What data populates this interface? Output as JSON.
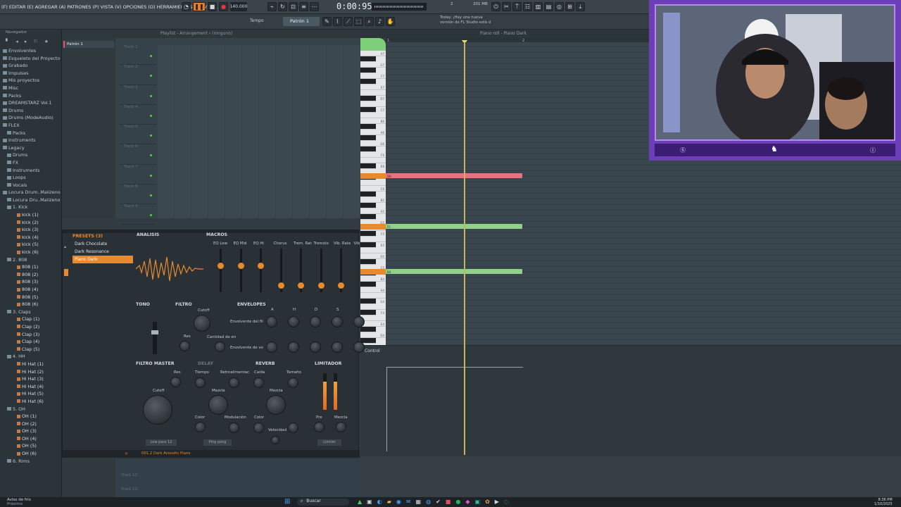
{
  "menu": {
    "items": [
      "(F) EDITAR (E) AGREGAR (A) PATRONES (P) VISTA (V) OPCIONES (O) HERRAMIENTAS (T) AYUDA"
    ]
  },
  "transport": {
    "tempo": "140.000",
    "time": "0:00:95",
    "pattern": "Patrón 1",
    "tempo_label": "Tempo",
    "hint_line1": "Today: ¡Hay una nueva",
    "hint_line2": "versión de FL Studio está d",
    "cpu": "2",
    "mem": "201 MB"
  },
  "browser": {
    "title": "Navegador",
    "items": [
      {
        "label": "Envolventes",
        "level": 1
      },
      {
        "label": "Esqueleto del Proyecto",
        "level": 1
      },
      {
        "label": "Grabado",
        "level": 1
      },
      {
        "label": "Impulses",
        "level": 1
      },
      {
        "label": "Mis proyectos",
        "level": 1
      },
      {
        "label": "Misc",
        "level": 1
      },
      {
        "label": "Packs",
        "level": 0
      },
      {
        "label": "DREAMSTARZ Vol.1",
        "level": 1
      },
      {
        "label": "Drums",
        "level": 1
      },
      {
        "label": "Drums (ModeAudio)",
        "level": 1
      },
      {
        "label": "FLEX",
        "level": 1
      },
      {
        "label": "Packs",
        "level": 2
      },
      {
        "label": "Instruments",
        "level": 1
      },
      {
        "label": "Legacy",
        "level": 1
      },
      {
        "label": "Drums",
        "level": 2
      },
      {
        "label": "FX",
        "level": 2
      },
      {
        "label": "Instruments",
        "level": 2
      },
      {
        "label": "Loops",
        "level": 2
      },
      {
        "label": "Vocals",
        "level": 2
      },
      {
        "label": "Locura Drum..Maiizeno",
        "level": 1
      },
      {
        "label": "Locura Dru..Maiizeno",
        "level": 2
      },
      {
        "label": "1. Kick",
        "level": 2
      },
      {
        "label": "kick (1)",
        "level": 3
      },
      {
        "label": "kick (2)",
        "level": 3
      },
      {
        "label": "kick (3)",
        "level": 3
      },
      {
        "label": "kick (4)",
        "level": 3
      },
      {
        "label": "kick (5)",
        "level": 3
      },
      {
        "label": "kick (6)",
        "level": 3
      },
      {
        "label": "2. 808",
        "level": 2
      },
      {
        "label": "808 (1)",
        "level": 3
      },
      {
        "label": "808 (2)",
        "level": 3
      },
      {
        "label": "808 (3)",
        "level": 3
      },
      {
        "label": "808 (4)",
        "level": 3
      },
      {
        "label": "808 (5)",
        "level": 3
      },
      {
        "label": "808 (6)",
        "level": 3
      },
      {
        "label": "3. Claps",
        "level": 2
      },
      {
        "label": "Clap (1)",
        "level": 3
      },
      {
        "label": "Clap (2)",
        "level": 3
      },
      {
        "label": "Clap (3)",
        "level": 3
      },
      {
        "label": "Clap (4)",
        "level": 3
      },
      {
        "label": "Clap (5)",
        "level": 3
      },
      {
        "label": "4. HH",
        "level": 2
      },
      {
        "label": "Hi Hat (1)",
        "level": 3
      },
      {
        "label": "Hi Hat (2)",
        "level": 3
      },
      {
        "label": "Hi Hat (3)",
        "level": 3
      },
      {
        "label": "Hi Hat (4)",
        "level": 3
      },
      {
        "label": "Hi Hat (5)",
        "level": 3
      },
      {
        "label": "Hi Hat (6)",
        "level": 3
      },
      {
        "label": "5. OH",
        "level": 2
      },
      {
        "label": "OH (1)",
        "level": 3
      },
      {
        "label": "OH (2)",
        "level": 3
      },
      {
        "label": "OH (3)",
        "level": 3
      },
      {
        "label": "OH (4)",
        "level": 3
      },
      {
        "label": "OH (5)",
        "level": 3
      },
      {
        "label": "OH (6)",
        "level": 3
      },
      {
        "label": "6. Rims",
        "level": 2
      }
    ]
  },
  "playlist": {
    "title": "Playlist - Arrangement › (ninguno)",
    "pattern_item": "Patrón 1",
    "tracks": [
      "Track 1",
      "Track 2",
      "Track 3",
      "Track 4",
      "Track 5",
      "Track 6",
      "Track 7",
      "Track 8",
      "Track 9"
    ],
    "bottom_tracks": [
      "Track 12",
      "Track 13"
    ]
  },
  "pianoroll": {
    "title": "Piano roll - Piano Dark",
    "keys": [
      "A7",
      "G7",
      "F7",
      "E7",
      "D7",
      "C7",
      "B6",
      "A6",
      "G6",
      "F6",
      "E6",
      "D6",
      "C6",
      "B5",
      "A5",
      "G5",
      "F5",
      "E5",
      "D5",
      "C5",
      "B4",
      "A4",
      "G4",
      "F4",
      "E4",
      "D4",
      "C4"
    ],
    "notes": [
      {
        "label": "D6",
        "color": "#e6737f",
        "start": 0,
        "length": 2
      },
      {
        "label": "F5",
        "color": "#8fd18a",
        "start": 0,
        "length": 2
      },
      {
        "label": "B4",
        "color": "#8fd18a",
        "start": 0,
        "length": 2
      }
    ],
    "bar_labels": [
      "1",
      "2"
    ],
    "control_label": "Control"
  },
  "plugin": {
    "presets_title": "PRESETS (3)",
    "presets": [
      "Dark Chocolate",
      "Dark Resonance",
      "Piano Dark"
    ],
    "selected_preset": "Piano Dark",
    "analysis": "ANALISIS",
    "macros": "MACROS",
    "macro_labels": [
      "EQ Low",
      "EQ Mid",
      "EQ Hi",
      "Chorus",
      "Trem. Rat",
      "Tremolo",
      "Vib. Rate",
      "Vib"
    ],
    "macro_levels": [
      0.62,
      0.62,
      0.62,
      0.1,
      0.1,
      0.1,
      0.1
    ],
    "tono": "TONO",
    "filtro": "FILTRO",
    "cutoff": "Cutoff",
    "res": "Res",
    "cantidad": "Cantidad de en",
    "envelopes": "ENVELOPES",
    "env_labels": [
      "A",
      "H",
      "D",
      "S"
    ],
    "env_rows": [
      "Envolvente del fil",
      "Envolvente de vo"
    ],
    "filtro_master": "FILTRO MASTER",
    "delay": "DELAY",
    "reverb": "REVERB",
    "limitador": "LIMITADOR",
    "fm_labels": [
      "Res",
      "Cutoff",
      "Color"
    ],
    "delay_labels": [
      "Tiempo",
      "Retroalimentac",
      "Mezcla",
      "Modulación"
    ],
    "reverb_labels": [
      "Caída",
      "Tamaño",
      "Mezcla",
      "Color",
      "Velocidad"
    ],
    "lim_labels": [
      "Pre",
      "Mezcla"
    ],
    "bottom_buttons": [
      "Low pass 12",
      "Ping pong",
      "Limiter"
    ],
    "footer": "001.2 Dark Acoustic Piano"
  },
  "taskbar": {
    "weather_1": "Aviso de frío",
    "weather_2": "Próximo",
    "search": "Buscar",
    "time": "8:36 PM",
    "date": "1/10/2025"
  }
}
